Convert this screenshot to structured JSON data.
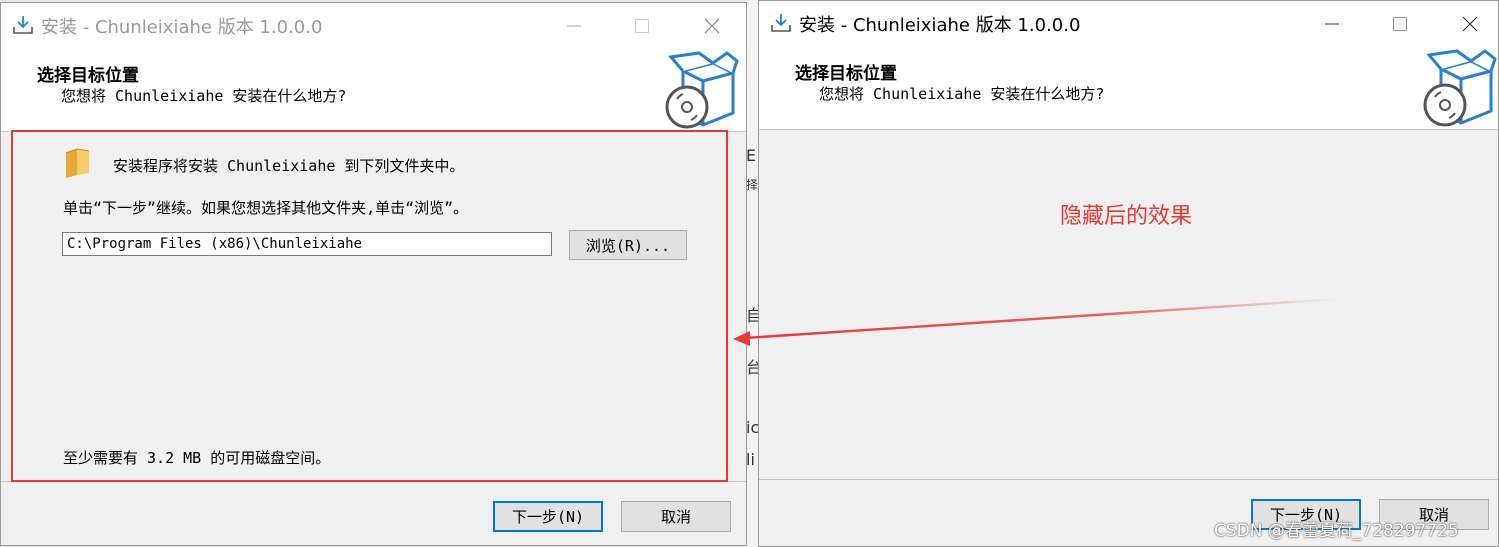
{
  "left_window": {
    "title": "安装 - Chunleixiahe 版本 1.0.0.0",
    "header_title": "选择目标位置",
    "header_subtitle": "您想将 Chunleixiahe 安装在什么地方?",
    "folder_message": "安装程序将安装 Chunleixiahe 到下列文件夹中。",
    "instruction": "单击“下一步”继续。如果您想选择其他文件夹,单击“浏览”。",
    "install_path": "C:\\Program Files (x86)\\Chunleixiahe",
    "browse_label": "浏览(R)...",
    "disk_space": "至少需要有 3.2 MB 的可用磁盘空间。",
    "next_label": "下一步(N)",
    "cancel_label": "取消"
  },
  "right_window": {
    "title": "安装 - Chunleixiahe 版本 1.0.0.0",
    "header_title": "选择目标位置",
    "header_subtitle": "您想将 Chunleixiahe 安装在什么地方?",
    "next_label": "下一步(N)",
    "cancel_label": "取消"
  },
  "annotation": {
    "text": "隐藏后的效果",
    "color": "#e53935"
  },
  "watermark": "CSDN @春蕾夏荷_728297725",
  "background_chars": [
    "E",
    "择",
    "自",
    "台",
    "ic",
    "li"
  ],
  "icons": {
    "title_icon": "download-install-icon",
    "header_icon": "software-box-cd-icon",
    "folder_icon": "folder-icon",
    "minimize": "minimize-icon",
    "maximize": "maximize-icon",
    "close": "close-icon"
  },
  "colors": {
    "accent": "#0078d7",
    "window_bg": "#f0f0f0",
    "header_bg": "#ffffff"
  }
}
